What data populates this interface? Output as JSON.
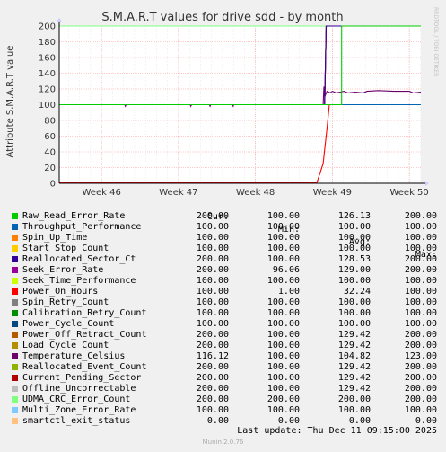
{
  "chart_data": {
    "type": "line",
    "title": "S.M.A.R.T values for drive sdd - by month",
    "ylabel": "Attribute S.M.A.R.T value",
    "xlabel": "",
    "side_label": "RRDTOOL / TOBI OETIKER",
    "ylim": [
      0,
      200
    ],
    "yticks": [
      0,
      20,
      40,
      60,
      80,
      100,
      120,
      140,
      160,
      180,
      200
    ],
    "xticks": [
      "Week 46",
      "Week 47",
      "Week 48",
      "Week 49",
      "Week 50"
    ],
    "xrange_weeks": [
      45.45,
      50.15
    ],
    "grid": true,
    "series": [
      {
        "name": "Raw_Read_Error_Rate",
        "color": "#00cc00",
        "cur": "200.00",
        "min": "100.00",
        "avg": "126.13",
        "max": "200.00",
        "points": [
          [
            45.45,
            100
          ],
          [
            49.12,
            100
          ],
          [
            49.12,
            200
          ],
          [
            50.15,
            200
          ]
        ]
      },
      {
        "name": "Throughput_Performance",
        "color": "#0066b3",
        "cur": "100.00",
        "min": "100.00",
        "avg": "100.00",
        "max": "100.00",
        "points": [
          [
            45.45,
            100
          ],
          [
            50.15,
            100
          ]
        ]
      },
      {
        "name": "Spin_Up_Time",
        "color": "#ff8000",
        "cur": "100.00",
        "min": "100.00",
        "avg": "100.00",
        "max": "100.00",
        "points": [
          [
            45.45,
            100
          ],
          [
            50.15,
            100
          ]
        ]
      },
      {
        "name": "Start_Stop_Count",
        "color": "#ffcc00",
        "cur": "100.00",
        "min": "100.00",
        "avg": "100.00",
        "max": "100.00",
        "points": [
          [
            45.45,
            100
          ],
          [
            50.15,
            100
          ]
        ]
      },
      {
        "name": "Reallocated_Sector_Ct",
        "color": "#330099",
        "cur": "200.00",
        "min": "100.00",
        "avg": "128.53",
        "max": "200.00",
        "points": [
          [
            45.45,
            100
          ],
          [
            48.9,
            100
          ],
          [
            48.92,
            200
          ],
          [
            50.15,
            200
          ]
        ]
      },
      {
        "name": "Seek_Error_Rate",
        "color": "#990099",
        "cur": "200.00",
        "min": "96.06",
        "avg": "129.00",
        "max": "200.00",
        "points": [
          [
            45.45,
            100
          ],
          [
            46.3,
            100
          ],
          [
            46.31,
            98
          ],
          [
            46.32,
            100
          ],
          [
            47.15,
            100
          ],
          [
            47.16,
            98
          ],
          [
            47.17,
            100
          ],
          [
            47.4,
            100
          ],
          [
            47.41,
            98
          ],
          [
            47.42,
            100
          ],
          [
            47.7,
            100
          ],
          [
            47.71,
            98
          ],
          [
            47.72,
            100
          ],
          [
            48.9,
            100
          ],
          [
            48.92,
            200
          ],
          [
            50.15,
            200
          ]
        ]
      },
      {
        "name": "Seek_Time_Performance",
        "color": "#ccff00",
        "cur": "100.00",
        "min": "100.00",
        "avg": "100.00",
        "max": "100.00",
        "points": [
          [
            45.45,
            100
          ],
          [
            50.15,
            100
          ]
        ]
      },
      {
        "name": "Power_On_Hours",
        "color": "#ff0000",
        "cur": "100.00",
        "min": "1.00",
        "avg": "32.24",
        "max": "100.00",
        "points": [
          [
            45.45,
            1
          ],
          [
            48.8,
            1
          ],
          [
            48.88,
            25
          ],
          [
            48.93,
            70
          ],
          [
            48.96,
            100
          ],
          [
            50.15,
            100
          ]
        ]
      },
      {
        "name": "Spin_Retry_Count",
        "color": "#808080",
        "cur": "100.00",
        "min": "100.00",
        "avg": "100.00",
        "max": "100.00",
        "points": [
          [
            45.45,
            100
          ],
          [
            50.15,
            100
          ]
        ]
      },
      {
        "name": "Calibration_Retry_Count",
        "color": "#008f00",
        "cur": "100.00",
        "min": "100.00",
        "avg": "100.00",
        "max": "100.00",
        "points": [
          [
            45.45,
            100
          ],
          [
            50.15,
            100
          ]
        ]
      },
      {
        "name": "Power_Cycle_Count",
        "color": "#00487d",
        "cur": "100.00",
        "min": "100.00",
        "avg": "100.00",
        "max": "100.00",
        "points": [
          [
            45.45,
            100
          ],
          [
            50.15,
            100
          ]
        ]
      },
      {
        "name": "Power_Off_Retract_Count",
        "color": "#b35a00",
        "cur": "200.00",
        "min": "100.00",
        "avg": "129.42",
        "max": "200.00",
        "points": [
          [
            45.45,
            100
          ],
          [
            48.9,
            100
          ],
          [
            48.92,
            200
          ],
          [
            50.15,
            200
          ]
        ]
      },
      {
        "name": "Load_Cycle_Count",
        "color": "#b38f00",
        "cur": "200.00",
        "min": "100.00",
        "avg": "129.42",
        "max": "200.00",
        "points": [
          [
            45.45,
            100
          ],
          [
            48.9,
            100
          ],
          [
            48.92,
            200
          ],
          [
            50.15,
            200
          ]
        ]
      },
      {
        "name": "Temperature_Celsius",
        "color": "#6b006b",
        "cur": "116.12",
        "min": "100.00",
        "avg": "104.82",
        "max": "123.00",
        "points": [
          [
            45.45,
            100
          ],
          [
            48.88,
            100
          ],
          [
            48.89,
            123
          ],
          [
            48.9,
            110
          ],
          [
            48.93,
            117
          ],
          [
            48.97,
            115
          ],
          [
            49.0,
            117
          ],
          [
            49.05,
            115
          ],
          [
            49.1,
            116
          ],
          [
            49.15,
            117
          ],
          [
            49.2,
            115
          ],
          [
            49.3,
            116
          ],
          [
            49.4,
            115
          ],
          [
            49.45,
            117
          ],
          [
            49.6,
            118
          ],
          [
            49.8,
            117
          ],
          [
            50.0,
            117
          ],
          [
            50.05,
            115
          ],
          [
            50.15,
            116
          ]
        ]
      },
      {
        "name": "Reallocated_Event_Count",
        "color": "#8fb300",
        "cur": "200.00",
        "min": "100.00",
        "avg": "129.42",
        "max": "200.00",
        "points": [
          [
            45.45,
            100
          ],
          [
            48.9,
            100
          ],
          [
            48.92,
            200
          ],
          [
            50.15,
            200
          ]
        ]
      },
      {
        "name": "Current_Pending_Sector",
        "color": "#b30000",
        "cur": "200.00",
        "min": "100.00",
        "avg": "129.42",
        "max": "200.00",
        "points": [
          [
            45.45,
            100
          ],
          [
            48.9,
            100
          ],
          [
            48.92,
            200
          ],
          [
            50.15,
            200
          ]
        ]
      },
      {
        "name": "Offline_Uncorrectable",
        "color": "#bebebe",
        "cur": "200.00",
        "min": "100.00",
        "avg": "129.42",
        "max": "200.00",
        "points": [
          [
            45.45,
            100
          ],
          [
            48.9,
            100
          ],
          [
            48.92,
            200
          ],
          [
            50.15,
            200
          ]
        ]
      },
      {
        "name": "UDMA_CRC_Error_Count",
        "color": "#80ff80",
        "cur": "200.00",
        "min": "200.00",
        "avg": "200.00",
        "max": "200.00",
        "points": [
          [
            45.45,
            200
          ],
          [
            50.15,
            200
          ]
        ]
      },
      {
        "name": "Multi_Zone_Error_Rate",
        "color": "#80c9ff",
        "cur": "100.00",
        "min": "100.00",
        "avg": "100.00",
        "max": "100.00",
        "points": [
          [
            45.45,
            100
          ],
          [
            50.15,
            100
          ]
        ]
      },
      {
        "name": "smartctl_exit_status",
        "color": "#ffc080",
        "cur": "0.00",
        "min": "0.00",
        "avg": "0.00",
        "max": "0.00",
        "points": [
          [
            45.45,
            0
          ],
          [
            50.15,
            0
          ]
        ]
      }
    ]
  },
  "legend_header": {
    "cur": "Cur:",
    "min": "Min:",
    "avg": "Avg:",
    "max": "Max:"
  },
  "last_update": "Last update: Thu Dec 11 09:15:00 2025",
  "footer": "Munin 2.0.76"
}
